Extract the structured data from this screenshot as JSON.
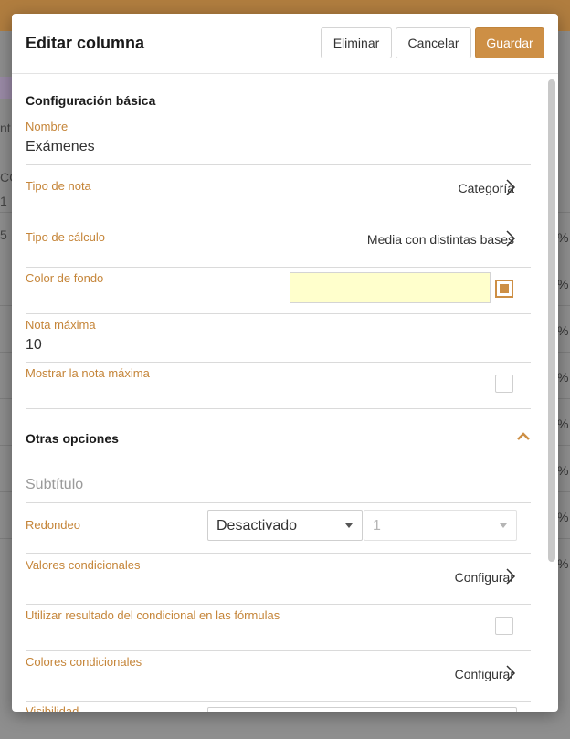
{
  "modal": {
    "title": "Editar columna",
    "buttons": {
      "delete": "Eliminar",
      "cancel": "Cancelar",
      "save": "Guardar"
    }
  },
  "basic": {
    "section_title": "Configuración básica",
    "name": {
      "label": "Nombre",
      "value": "Exámenes"
    },
    "grade_type": {
      "label": "Tipo de nota",
      "value": "Categoría"
    },
    "calc_type": {
      "label": "Tipo de cálculo",
      "value": "Media con distintas bases"
    },
    "bg_color": {
      "label": "Color de fondo",
      "color": "#ffffcc"
    },
    "max_grade": {
      "label": "Nota máxima",
      "value": "10"
    },
    "show_max": {
      "label": "Mostrar la nota máxima",
      "checked": false
    }
  },
  "other": {
    "section_title": "Otras opciones",
    "subtitle_placeholder": "Subtítulo",
    "rounding": {
      "label": "Redondeo",
      "selected": "Desactivado",
      "decimals": "1"
    },
    "conditional_values": {
      "label": "Valores condicionales",
      "action": "Configurar"
    },
    "use_conditional": {
      "label": "Utilizar resultado del condicional en las fórmulas",
      "checked": false
    },
    "conditional_colors": {
      "label": "Colores condicionales",
      "action": "Configurar"
    },
    "visibility": {
      "label": "Visibilidad"
    }
  },
  "background": {
    "left_fragments": [
      "nt",
      "CC",
      "1",
      "5"
    ],
    "right_fragments": [
      "%",
      "%",
      "%",
      "%",
      "%",
      "%",
      "%",
      "%"
    ]
  },
  "colors": {
    "accent": "#cd8f45",
    "label": "#c58539",
    "topbar": "#b07d3f"
  }
}
